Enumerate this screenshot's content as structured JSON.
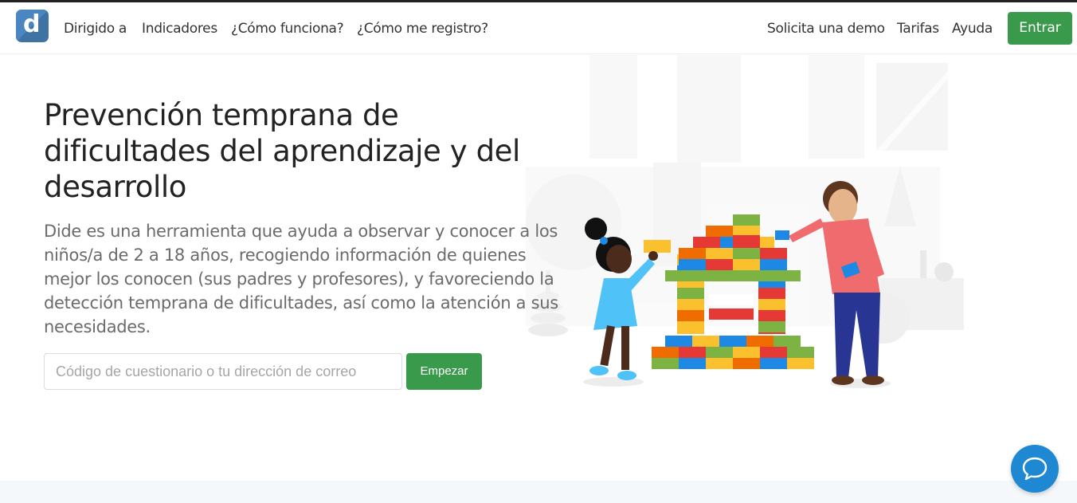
{
  "nav": {
    "logo_letter": "d",
    "links": [
      "Dirigido a",
      "Indicadores",
      "¿Cómo funciona?",
      "¿Cómo me registro?"
    ],
    "right_links": [
      "Solicita una demo",
      "Tarifas",
      "Ayuda"
    ],
    "enter_label": "Entrar"
  },
  "hero": {
    "title": "Prevención temprana de dificultades del aprendizaje y del desarrollo",
    "description": "Dide es una herramienta que ayuda a observar y conocer a los niños/a de 2 a 18 años, recogiendo información de quienes mejor los conocen (sus padres y profesores), y favoreciendo la detección temprana de dificultades, así como la atención a sus necesidades.",
    "input_placeholder": "Código de cuestionario o tu dirección de correo",
    "start_label": "Empezar"
  },
  "colors": {
    "brand_blue": "#3f73a4",
    "accent_green": "#3a9a4b",
    "chat_blue": "#1e88d2"
  },
  "icons": {
    "chat": "chat-bubble-icon",
    "logo": "dide-logo"
  }
}
